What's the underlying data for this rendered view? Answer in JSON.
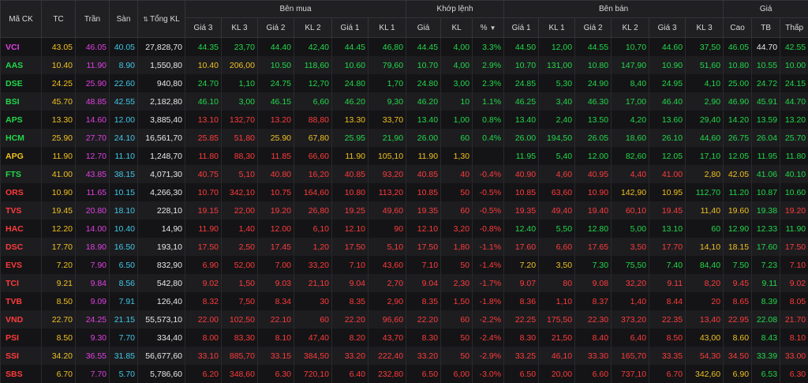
{
  "colors": {
    "ref": "#f0c020",
    "ceil": "#e040e0",
    "floor": "#40c8e8",
    "up": "#22d84a",
    "down": "#ff3b3b",
    "neutral": "#e8e8e8"
  },
  "header": {
    "symbol": "Mã CK",
    "ref": "TC",
    "ceil": "Trần",
    "floor": "Sàn",
    "total": "Tổng KL",
    "buy_group": "Bên mua",
    "match_group": "Khớp lệnh",
    "sell_group": "Bên bán",
    "price_group": "Giá",
    "buy_cols": [
      "Giá 3",
      "KL 3",
      "Giá 2",
      "KL 2",
      "Giá 1",
      "KL 1"
    ],
    "match_cols": [
      "Giá",
      "KL",
      "%"
    ],
    "sell_cols": [
      "Giá 1",
      "KL 1",
      "Giá 2",
      "KL 2",
      "Giá 3",
      "KL 3"
    ],
    "price_cols": [
      "Cao",
      "TB",
      "Thấp"
    ]
  },
  "rows": [
    {
      "cells": [
        "VCI",
        "43.05",
        "46.05",
        "40.05",
        "27,828,70",
        "44.35",
        "23,70",
        "44.40",
        "42,40",
        "44.45",
        "46,80",
        "44.45",
        "4,00",
        "3.3%",
        "44.50",
        "12,00",
        "44.55",
        "10,70",
        "44.60",
        "37,50",
        "46.05",
        "44.70",
        "42.55"
      ],
      "c": "CRCFWUUUUUUUUUUUUUUUUXUD"
    },
    {
      "cells": [
        "AAS",
        "10.40",
        "11.90",
        "8.90",
        "1,550,80",
        "10.40",
        "206,00",
        "10.50",
        "118,60",
        "10.60",
        "79,60",
        "10.70",
        "4,00",
        "2.9%",
        "10.70",
        "131,00",
        "10.80",
        "147,90",
        "10.90",
        "51,60",
        "10.80",
        "10.55",
        "10.00"
      ],
      "c": "URCFWRRUUUUUUUUUUUUUUUUD"
    },
    {
      "cells": [
        "DSE",
        "24.25",
        "25.90",
        "22.60",
        "940,80",
        "24.70",
        "1,10",
        "24.75",
        "12,70",
        "24.80",
        "1,70",
        "24.80",
        "3,00",
        "2.3%",
        "24.85",
        "5,30",
        "24.90",
        "8,40",
        "24.95",
        "4,10",
        "25.00",
        "24.72",
        "24.15"
      ],
      "c": "URCFWUUUUUUUUUUUUUUUUUUD"
    },
    {
      "cells": [
        "BSI",
        "45.70",
        "48.85",
        "42.55",
        "2,182,80",
        "46.10",
        "3,00",
        "46.15",
        "6,60",
        "46.20",
        "9,30",
        "46.20",
        "10",
        "1.1%",
        "46.25",
        "3,40",
        "46.30",
        "17,00",
        "46.40",
        "2,90",
        "46.90",
        "45.91",
        "44.70"
      ],
      "c": "URCFWUUUUUUUUUUUUUUUUUUD"
    },
    {
      "cells": [
        "APS",
        "13.30",
        "14.60",
        "12.00",
        "3,885,40",
        "13.10",
        "132,70",
        "13.20",
        "88,80",
        "13.30",
        "33,70",
        "13.40",
        "1,00",
        "0.8%",
        "13.40",
        "2,40",
        "13.50",
        "4,20",
        "13.60",
        "29,40",
        "14.20",
        "13.59",
        "13.20"
      ],
      "c": "URCFWDDDDRRUUUUUUUUUUUUD"
    },
    {
      "cells": [
        "HCM",
        "25.90",
        "27.70",
        "24.10",
        "16,561,70",
        "25.85",
        "51,80",
        "25.90",
        "67,80",
        "25.95",
        "21,90",
        "26.00",
        "60",
        "0.4%",
        "26.00",
        "194,50",
        "26.05",
        "18,60",
        "26.10",
        "44,60",
        "26.75",
        "26.04",
        "25.70"
      ],
      "c": "URCFWDDRRUUUUUUUUUUUUUUD"
    },
    {
      "cells": [
        "APG",
        "11.90",
        "12.70",
        "11.10",
        "1,248,70",
        "11.80",
        "88,30",
        "11.85",
        "66,60",
        "11.90",
        "105,10",
        "11.90",
        "1,30",
        "",
        "11.95",
        "5,40",
        "12.00",
        "82,60",
        "12.05",
        "17,10",
        "12.05",
        "11.95",
        "11.80"
      ],
      "c": "RRCFWDDDDRRRRRUUUUUUUUUD"
    },
    {
      "cells": [
        "FTS",
        "41.00",
        "43.85",
        "38.15",
        "4,071,30",
        "40.75",
        "5,10",
        "40.80",
        "16,20",
        "40.85",
        "93,20",
        "40.85",
        "40",
        "-0.4%",
        "40.90",
        "4,60",
        "40.95",
        "4,40",
        "41.00",
        "2,80",
        "42.05",
        "41.06",
        "40.10"
      ],
      "c": "URCFWDDDDDDDDDDDDDDRRUUD"
    },
    {
      "cells": [
        "ORS",
        "10.90",
        "11.65",
        "10.15",
        "4,266,30",
        "10.70",
        "342,10",
        "10.75",
        "164,60",
        "10.80",
        "113,20",
        "10.85",
        "50",
        "-0.5%",
        "10.85",
        "63,60",
        "10.90",
        "142,90",
        "10.95",
        "112,70",
        "11.20",
        "10.87",
        "10.60"
      ],
      "c": "DRCFWDDDDDDDDDDDDRRUUUUD"
    },
    {
      "cells": [
        "TVS",
        "19.45",
        "20.80",
        "18.10",
        "228,10",
        "19.15",
        "22,00",
        "19.20",
        "26,80",
        "19.25",
        "49,60",
        "19.35",
        "60",
        "-0.5%",
        "19.35",
        "49,40",
        "19.40",
        "60,10",
        "19.45",
        "11,40",
        "19.60",
        "19.38",
        "19.20"
      ],
      "c": "DRCFWDDDDDDDDDDDDDDRRUDD"
    },
    {
      "cells": [
        "HAC",
        "12.20",
        "14.00",
        "10.40",
        "14,90",
        "11.90",
        "1,40",
        "12.00",
        "6,10",
        "12.10",
        "90",
        "12.10",
        "3,20",
        "-0.8%",
        "12.40",
        "5,50",
        "12.80",
        "5,00",
        "13.10",
        "60",
        "12.90",
        "12.33",
        "11.90"
      ],
      "c": "DRCFWDDDDDDDDDUUUUUUUUUD"
    },
    {
      "cells": [
        "DSC",
        "17.70",
        "18.90",
        "16.50",
        "193,10",
        "17.50",
        "2,50",
        "17.45",
        "1,20",
        "17.50",
        "5,10",
        "17.50",
        "1,80",
        "-1.1%",
        "17.60",
        "6,60",
        "17.65",
        "3,50",
        "17.70",
        "14,10",
        "18.15",
        "17.60",
        "17.50"
      ],
      "c": "DRCFWDDDDDDDDDDDDDDRRUDD"
    },
    {
      "cells": [
        "EVS",
        "7.20",
        "7.90",
        "6.50",
        "832,90",
        "6.90",
        "52,00",
        "7.00",
        "33,20",
        "7.10",
        "43,60",
        "7.10",
        "50",
        "-1.4%",
        "7.20",
        "3,50",
        "7.30",
        "75,50",
        "7.40",
        "84,40",
        "7.50",
        "7.23",
        "7.10"
      ],
      "c": "DRCFWDDDDDDDDDRRUUUUUUDD"
    },
    {
      "cells": [
        "TCI",
        "9.21",
        "9.84",
        "8.56",
        "542,80",
        "9.02",
        "1,50",
        "9.03",
        "21,10",
        "9.04",
        "2,70",
        "9.04",
        "2,30",
        "-1.7%",
        "9.07",
        "80",
        "9.08",
        "32,20",
        "9.11",
        "8,20",
        "9.45",
        "9.11",
        "9.02"
      ],
      "c": "DRCFWDDDDDDDDDDDDDDDDUDD"
    },
    {
      "cells": [
        "TVB",
        "8.50",
        "9.09",
        "7.91",
        "126,40",
        "8.32",
        "7,50",
        "8.34",
        "30",
        "8.35",
        "2,90",
        "8.35",
        "1,50",
        "-1.8%",
        "8.36",
        "1,10",
        "8.37",
        "1,40",
        "8.44",
        "20",
        "8.65",
        "8.39",
        "8.05"
      ],
      "c": "DRCFWDDDDDDDDDDDDDDDDUDD"
    },
    {
      "cells": [
        "VND",
        "22.70",
        "24.25",
        "21.15",
        "55,573,10",
        "22.00",
        "102,50",
        "22.10",
        "60",
        "22.20",
        "96,60",
        "22.20",
        "60",
        "-2.2%",
        "22.25",
        "175,50",
        "22.30",
        "373,20",
        "22.35",
        "13,40",
        "22.95",
        "22.08",
        "21.70"
      ],
      "c": "DRCFWDDDDDDDDDDDDDDDDUDD"
    },
    {
      "cells": [
        "PSI",
        "8.50",
        "9.30",
        "7.70",
        "334,40",
        "8.00",
        "83,30",
        "8.10",
        "47,40",
        "8.20",
        "43,70",
        "8.30",
        "50",
        "-2.4%",
        "8.30",
        "21,50",
        "8.40",
        "6,40",
        "8.50",
        "43,00",
        "8.60",
        "8.43",
        "8.10"
      ],
      "c": "DRCFWDDDDDDDDDDDDDDRRUDD"
    },
    {
      "cells": [
        "SSI",
        "34.20",
        "36.55",
        "31.85",
        "56,677,60",
        "33.10",
        "885,70",
        "33.15",
        "384,50",
        "33.20",
        "222,40",
        "33.20",
        "50",
        "-2.9%",
        "33.25",
        "46,10",
        "33.30",
        "165,70",
        "33.35",
        "54,30",
        "34.50",
        "33.39",
        "33.00"
      ],
      "c": "DRCFWDDDDDDDDDDDDDDDDUDD"
    },
    {
      "cells": [
        "SBS",
        "6.70",
        "7.70",
        "5.70",
        "5,786,60",
        "6.20",
        "348,60",
        "6.30",
        "720,10",
        "6.40",
        "232,80",
        "6.50",
        "6,00",
        "-3.0%",
        "6.50",
        "20,00",
        "6.60",
        "737,10",
        "6.70",
        "342,60",
        "6.90",
        "6.53",
        "6.30"
      ],
      "c": "DRCFWDDDDDDDDDDDDDDRRUDD"
    }
  ]
}
